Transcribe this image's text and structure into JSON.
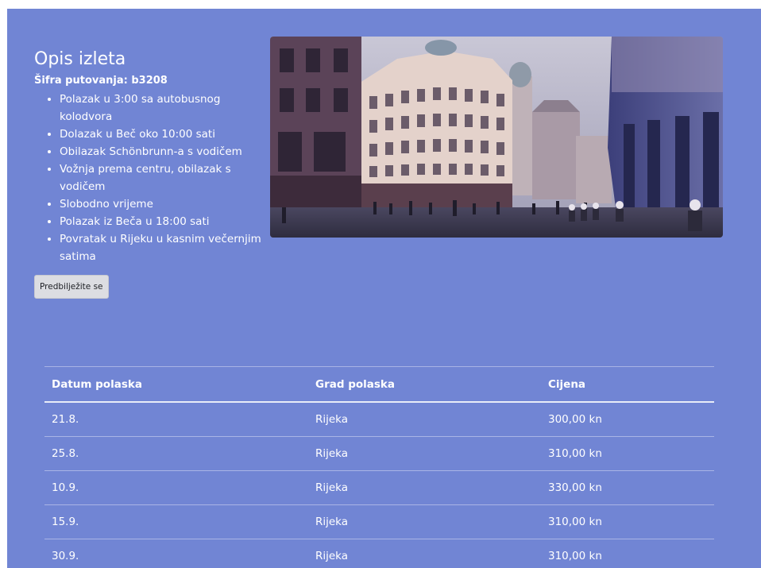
{
  "trip": {
    "title": "Opis izleta",
    "code_label": "Šifra putovanja:",
    "code_value": "b3208",
    "itinerary": [
      "Polazak u 3:00 sa autobusnog kolodvora",
      "Dolazak u Beč oko 10:00 sati",
      "Obilazak Schönbrunn-a s vodičem",
      "Vožnja prema centru, obilazak s vodičem",
      "Slobodno vrijeme",
      "Polazak iz Beča u 18:00 sati",
      "Povratak u Rijeku u kasnim večernjim satima"
    ],
    "book_button": "Predbilježite se"
  },
  "schedule": {
    "headers": [
      "Datum polaska",
      "Grad polaska",
      "Cijena"
    ],
    "rows": [
      [
        "21.8.",
        "Rijeka",
        "300,00 kn"
      ],
      [
        "25.8.",
        "Rijeka",
        "310,00 kn"
      ],
      [
        "10.9.",
        "Rijeka",
        "330,00 kn"
      ],
      [
        "15.9.",
        "Rijeka",
        "310,00 kn"
      ],
      [
        "30.9.",
        "Rijeka",
        "310,00 kn"
      ]
    ]
  },
  "colors": {
    "page_background": "#7185d4",
    "text": "#ffffff",
    "button_background": "#dcdde2"
  }
}
